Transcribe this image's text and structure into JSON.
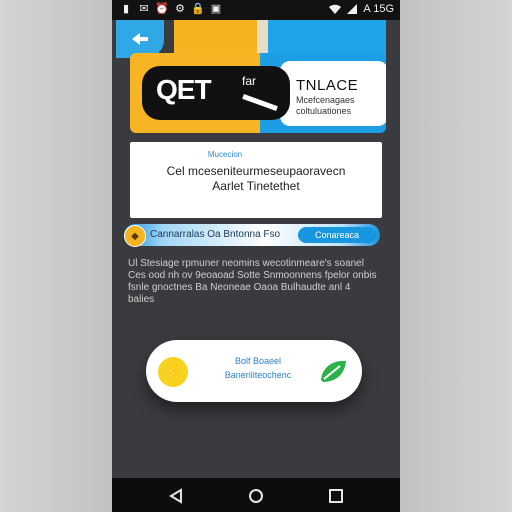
{
  "status_bar": {
    "left_icons": [
      "app-icon",
      "notification-icon",
      "alarm-icon",
      "settings-icon",
      "lock-icon",
      "briefcase-icon"
    ],
    "right_icons": [
      "wifi-icon",
      "signal-icon"
    ],
    "text": "A 15G"
  },
  "promo": {
    "logo_text": "QET",
    "logo_small": "far",
    "title": "TNLACE",
    "subtitle": "Mcefcenagaes coltuluationes"
  },
  "info_card": {
    "label": "Mucecion",
    "line1": "Cel mceseniteurmeseupaoravecn",
    "line2": "Aarlet Tinetethet"
  },
  "banner": {
    "text": "Cannarralas Oa Bntonna Fso",
    "button": "Conareaca"
  },
  "paragraph": "Ul Stesiage rpmuner neomins wecotinmeare's soanel Ces ood nh ov 9eoaoad Sotte Snmoonnens fpelor onbis fsnle gnoctnes Ba Neoneae Oaoa Bulhaudte anl 4 balies",
  "pill": {
    "line1": "Bolf Boaeel",
    "line2": "Baneriliteochenc"
  },
  "colors": {
    "yellow": "#f4b31f",
    "blue": "#1ea4e8",
    "background": "#3a3b3f"
  }
}
